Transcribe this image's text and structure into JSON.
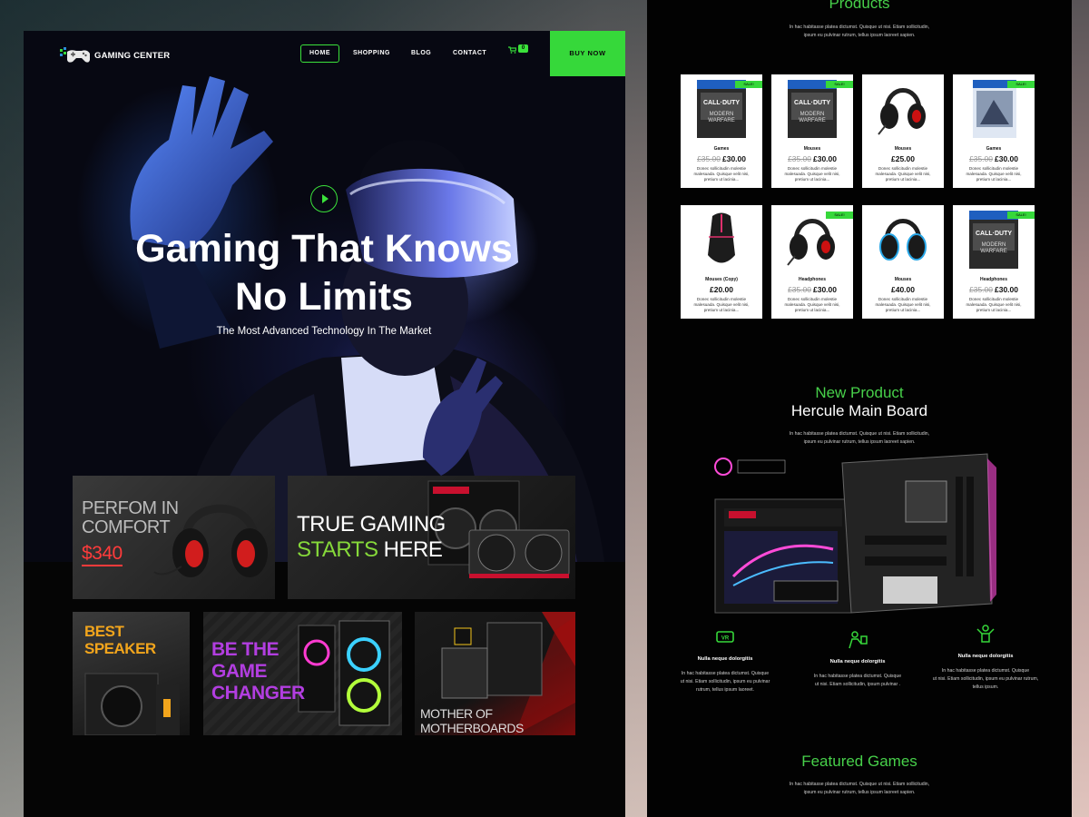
{
  "left_page": {
    "logo": {
      "text": "GAMING CENTER"
    },
    "nav": {
      "items": [
        "HOME",
        "SHOPPING",
        "BLOG",
        "CONTACT"
      ],
      "active": "HOME",
      "cart_count": "0",
      "buy_button": "BUY NOW"
    },
    "hero": {
      "title_line1": "Gaming That Knows",
      "title_line2": "No Limits",
      "subtitle": "The Most Advanced Technology In The Market"
    },
    "promos": {
      "headphones": {
        "line1": "PERFOM IN",
        "line2": "COMFORT",
        "price": "$340"
      },
      "gpu": {
        "line1": "TRUE GAMING",
        "line2_green": "STARTS",
        "line2_white": "HERE"
      },
      "speaker": {
        "line1": "BEST",
        "line2": "SPEAKER"
      },
      "pc": {
        "line1": "BE THE",
        "line2": "GAME",
        "line3": "CHANGER"
      },
      "motherboard": {
        "text": "MOTHER OF MOTHERBOARDS"
      }
    }
  },
  "right_page": {
    "products_section": {
      "title": "Products",
      "blurb_line1": "In hac habitasse platea dictumst. Quisque ut nisi. Etiam sollicitudin,",
      "blurb_line2": "ipsum eu pulvinar rutrum, tellus ipsum laoreet sapien."
    },
    "products": [
      {
        "image": "game-cover",
        "sale": "SALE!",
        "name": "Games",
        "old_price": "£35.00",
        "price": "£30.00",
        "desc": "Donec sollicitudin molestie malesuada. Quisque velit nisi, pretium ut lacinia..."
      },
      {
        "image": "game-cover",
        "sale": "SALE!",
        "name": "Mouses",
        "old_price": "£35.00",
        "price": "£30.00",
        "desc": "Donec sollicitudin molestie malesuada. Quisque velit nisi, pretium ut lacinia..."
      },
      {
        "image": "headset",
        "sale": "",
        "name": "Mouses",
        "old_price": "",
        "price": "£25.00",
        "desc": "Donec sollicitudin molestie malesuada. Quisque velit nisi, pretium ut lacinia..."
      },
      {
        "image": "game-cover-blue",
        "sale": "SALE!",
        "name": "Games",
        "old_price": "£35.00",
        "price": "£30.00",
        "desc": "Donec sollicitudin molestie malesuada. Quisque velit nisi, pretium ut lacinia..."
      },
      {
        "image": "mouse",
        "sale": "",
        "name": "Mouses (Copy)",
        "old_price": "",
        "price": "£20.00",
        "desc": "Donec sollicitudin molestie malesuada. Quisque velit nisi, pretium ut lacinia..."
      },
      {
        "image": "headset",
        "sale": "SALE!",
        "name": "Headphones",
        "old_price": "£35.00",
        "price": "£30.00",
        "desc": "Donec sollicitudin molestie malesuada. Quisque velit nisi, pretium ut lacinia..."
      },
      {
        "image": "headphones-blue",
        "sale": "",
        "name": "Mouses",
        "old_price": "",
        "price": "£40.00",
        "desc": "Donec sollicitudin molestie malesuada. Quisque velit nisi, pretium ut lacinia..."
      },
      {
        "image": "game-cover",
        "sale": "SALE!",
        "name": "Headphones",
        "old_price": "£35.00",
        "price": "£30.00",
        "desc": "Donec sollicitudin molestie malesuada. Quisque velit nisi, pretium ut lacinia..."
      }
    ],
    "new_product": {
      "title": "New Product",
      "subtitle": "Hercule Main Board",
      "blurb_line1": "In hac habitasse platea dictumst. Quisque ut nisi. Etiam sollicitudin,",
      "blurb_line2": "ipsum eu pulvinar rutrum, tellus ipsum laoreet sapien."
    },
    "features": [
      {
        "icon": "vr-headset-icon",
        "title": "Nulla neque dolorgitis",
        "text_line1": "In hac habitasse platea dictumst. Quisque",
        "text_line2": "ut nisi. Etiam sollicitudin, ipsum eu pulvinar",
        "text_line3": "rutrum, tellus ipsum laoreet."
      },
      {
        "icon": "gamer-icon",
        "title": "Nulla neque dolorgitis",
        "text_line1": "In hac habitasse platea dictumst. Quisque",
        "text_line2": "ut nisi. Etiam sollicitudin, ipsum pulvinar .",
        "text_line3": ""
      },
      {
        "icon": "winner-icon",
        "title": "Nulla neque dolorgitis",
        "text_line1": "In hac habitasse platea dictumst. Quisque",
        "text_line2": "ut nisi. Etiam sollicitudin, ipsum eu pulvinar rutrum,",
        "text_line3": "tellus ipsum."
      }
    ],
    "featured_games": {
      "title": "Featured Games",
      "blurb_line1": "In hac habitasse platea dictumst. Quisque ut nisi. Etiam sollicitudin,",
      "blurb_line2": "ipsum eu pulvinar rutrum, tellus ipsum laoreet sapien."
    }
  },
  "colors": {
    "accent": "#36d83a",
    "background": "#050505",
    "price_red": "#ff3b3b",
    "promo_orange": "#f2a51c",
    "promo_purple": "#b23ee0"
  }
}
